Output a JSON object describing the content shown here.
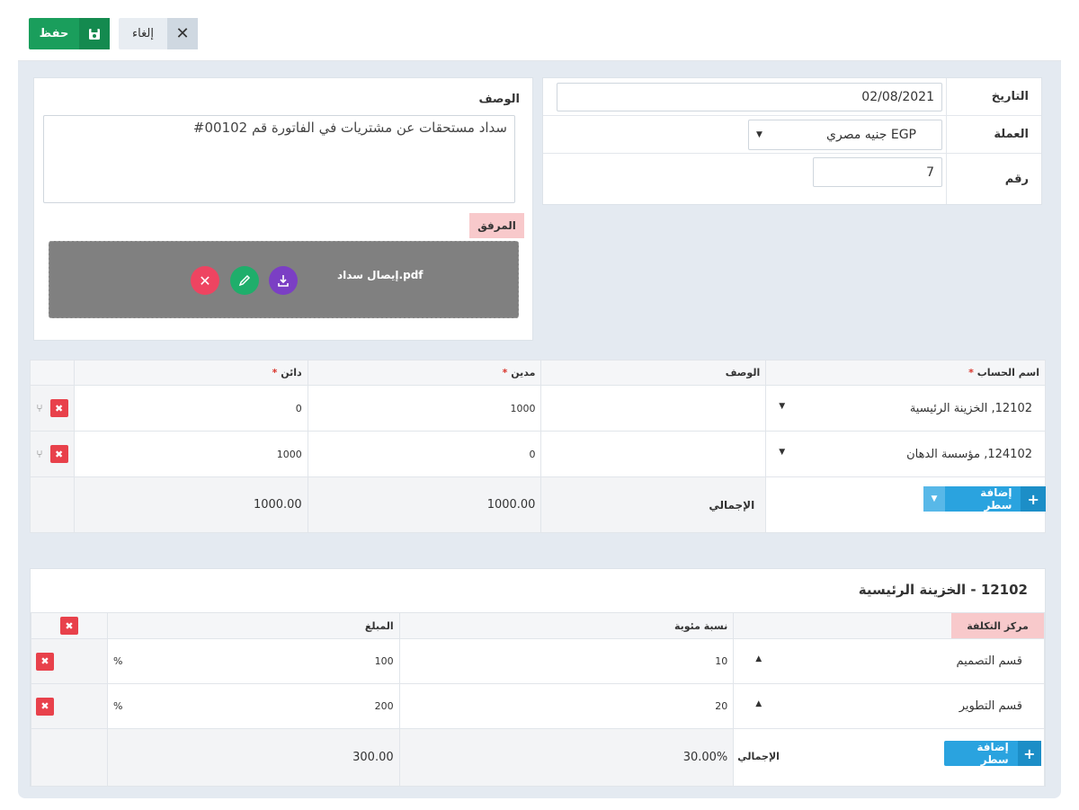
{
  "toolbar": {
    "save_label": "حفظ",
    "cancel_label": "إلغاء"
  },
  "form": {
    "date_label": "التاريخ",
    "date_value": "02/08/2021",
    "currency_label": "العملة",
    "currency_value": "EGP جنيه مصري",
    "number_label": "رقم",
    "number_value": "7"
  },
  "description": {
    "label": "الوصف",
    "value": "سداد مستحقات عن مشتريات في الفاتورة قم 00102#",
    "attachment_label": "المرفق",
    "file_name": "إيصال سداد.pdf"
  },
  "journal": {
    "headers": {
      "account": "اسم الحساب",
      "description": "الوصف",
      "debit": "مدين",
      "credit": "دائن"
    },
    "rows": [
      {
        "account": "12102, الخزينة الرئيسية",
        "description": "",
        "debit": "1000",
        "credit": "0"
      },
      {
        "account": "124102, مؤسسة الدهان",
        "description": "",
        "debit": "0",
        "credit": "1000"
      }
    ],
    "add_row_label": "إضافة سطر",
    "total_label": "الإجمالي",
    "total_debit": "1000.00",
    "total_credit": "1000.00"
  },
  "cost_center": {
    "title": "12102 - الخزينة الرئيسية",
    "headers": {
      "center": "مركز التكلفة",
      "percent": "نسبة مئوية",
      "amount": "المبلغ"
    },
    "rows": [
      {
        "center": "قسم التصميم",
        "percent": "10",
        "amount": "100"
      },
      {
        "center": "قسم التطوير",
        "percent": "20",
        "amount": "200"
      }
    ],
    "percent_sign": "%",
    "add_row_label": "إضافة سطر",
    "total_label": "الإجمالي",
    "total_percent": "30.00%",
    "total_amount": "300.00"
  },
  "colors": {
    "save_green": "#1a9e5c",
    "add_blue": "#2aa3df",
    "delete_red": "#e8414b",
    "attach_label_bg": "#f8c9cb"
  }
}
